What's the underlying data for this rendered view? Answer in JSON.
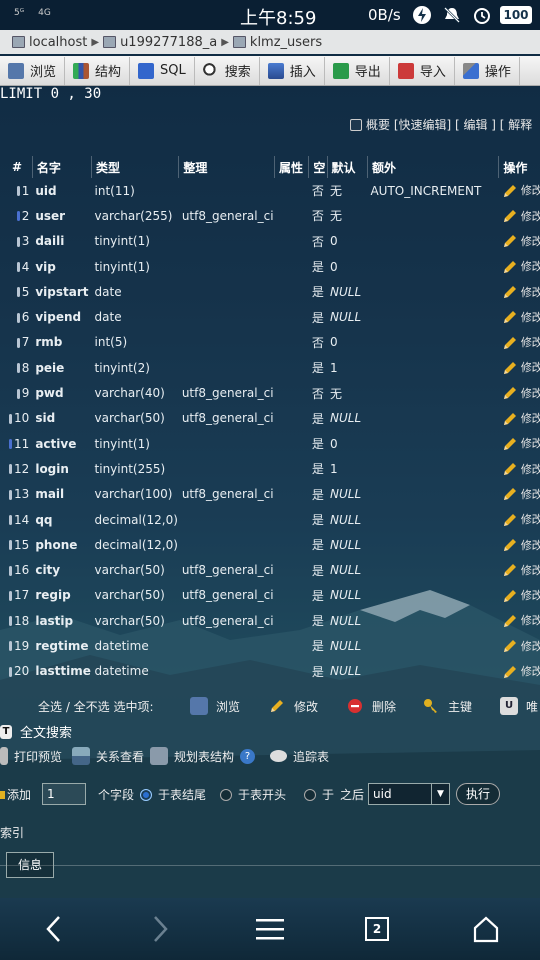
{
  "status_bar": {
    "left_text_1": "5ᴳ",
    "left_text_2": "4G",
    "time": "上午8:59",
    "net_speed": "0B/s",
    "battery": "100"
  },
  "breadcrumb": [
    "localhost",
    "u199277188_a",
    "klmz_users"
  ],
  "tabs": [
    {
      "label": "浏览",
      "icon": "browse-icon"
    },
    {
      "label": "结构",
      "icon": "structure-icon"
    },
    {
      "label": "SQL",
      "icon": "sql-icon"
    },
    {
      "label": "搜索",
      "icon": "search-icon"
    },
    {
      "label": "插入",
      "icon": "insert-icon"
    },
    {
      "label": "导出",
      "icon": "export-icon"
    },
    {
      "label": "导入",
      "icon": "import-icon"
    },
    {
      "label": "操作",
      "icon": "operations-icon"
    }
  ],
  "limit_text": "LIMIT 0 , 30",
  "top_links": "概要 [快速编辑] [ 编辑 ] [ 解释",
  "table": {
    "headers": [
      "#",
      "名字",
      "类型",
      "整理",
      "属性",
      "空",
      "默认",
      "额外",
      "操作"
    ],
    "edit_label": "修改",
    "rows": [
      {
        "n": "1",
        "name": "uid",
        "type": "int(11)",
        "coll": "",
        "null": "否",
        "def": "无",
        "extra": "AUTO_INCREMENT"
      },
      {
        "n": "2",
        "name": "user",
        "type": "varchar(255)",
        "coll": "utf8_general_ci",
        "null": "否",
        "def": "无",
        "extra": ""
      },
      {
        "n": "3",
        "name": "daili",
        "type": "tinyint(1)",
        "coll": "",
        "null": "否",
        "def": "0",
        "extra": ""
      },
      {
        "n": "4",
        "name": "vip",
        "type": "tinyint(1)",
        "coll": "",
        "null": "是",
        "def": "0",
        "extra": ""
      },
      {
        "n": "5",
        "name": "vipstart",
        "type": "date",
        "coll": "",
        "null": "是",
        "def": "NULL",
        "extra": ""
      },
      {
        "n": "6",
        "name": "vipend",
        "type": "date",
        "coll": "",
        "null": "是",
        "def": "NULL",
        "extra": ""
      },
      {
        "n": "7",
        "name": "rmb",
        "type": "int(5)",
        "coll": "",
        "null": "否",
        "def": "0",
        "extra": ""
      },
      {
        "n": "8",
        "name": "peie",
        "type": "tinyint(2)",
        "coll": "",
        "null": "是",
        "def": "1",
        "extra": ""
      },
      {
        "n": "9",
        "name": "pwd",
        "type": "varchar(40)",
        "coll": "utf8_general_ci",
        "null": "否",
        "def": "无",
        "extra": ""
      },
      {
        "n": "10",
        "name": "sid",
        "type": "varchar(50)",
        "coll": "utf8_general_ci",
        "null": "是",
        "def": "NULL",
        "extra": ""
      },
      {
        "n": "11",
        "name": "active",
        "type": "tinyint(1)",
        "coll": "",
        "null": "是",
        "def": "0",
        "extra": ""
      },
      {
        "n": "12",
        "name": "login",
        "type": "tinyint(255)",
        "coll": "",
        "null": "是",
        "def": "1",
        "extra": ""
      },
      {
        "n": "13",
        "name": "mail",
        "type": "varchar(100)",
        "coll": "utf8_general_ci",
        "null": "是",
        "def": "NULL",
        "extra": ""
      },
      {
        "n": "14",
        "name": "qq",
        "type": "decimal(12,0)",
        "coll": "",
        "null": "是",
        "def": "NULL",
        "extra": ""
      },
      {
        "n": "15",
        "name": "phone",
        "type": "decimal(12,0)",
        "coll": "",
        "null": "是",
        "def": "NULL",
        "extra": ""
      },
      {
        "n": "16",
        "name": "city",
        "type": "varchar(50)",
        "coll": "utf8_general_ci",
        "null": "是",
        "def": "NULL",
        "extra": ""
      },
      {
        "n": "17",
        "name": "regip",
        "type": "varchar(50)",
        "coll": "utf8_general_ci",
        "null": "是",
        "def": "NULL",
        "extra": ""
      },
      {
        "n": "18",
        "name": "lastip",
        "type": "varchar(50)",
        "coll": "utf8_general_ci",
        "null": "是",
        "def": "NULL",
        "extra": ""
      },
      {
        "n": "19",
        "name": "regtime",
        "type": "datetime",
        "coll": "",
        "null": "是",
        "def": "NULL",
        "extra": ""
      },
      {
        "n": "20",
        "name": "lasttime",
        "type": "datetime",
        "coll": "",
        "null": "是",
        "def": "NULL",
        "extra": ""
      }
    ]
  },
  "selection_bar": {
    "select_text": "全选 / 全不选 选中项:",
    "browse": "浏览",
    "edit": "修改",
    "delete": "删除",
    "primary": "主键",
    "unique": "唯"
  },
  "fulltext": "全文搜索",
  "tools": {
    "print": "打印预览",
    "relations": "关系查看",
    "plan": "规划表结构",
    "track": "追踪表"
  },
  "add_fields": {
    "add_label": "添加",
    "count": "1",
    "fields_label": "个字段",
    "at_end": "于表结尾",
    "at_start": "于表开头",
    "after": "于",
    "after_suffix": "之后",
    "after_field": "uid",
    "go": "执行"
  },
  "index_label": "索引",
  "info_label": "信息",
  "nav": {
    "tab_count": "2"
  }
}
